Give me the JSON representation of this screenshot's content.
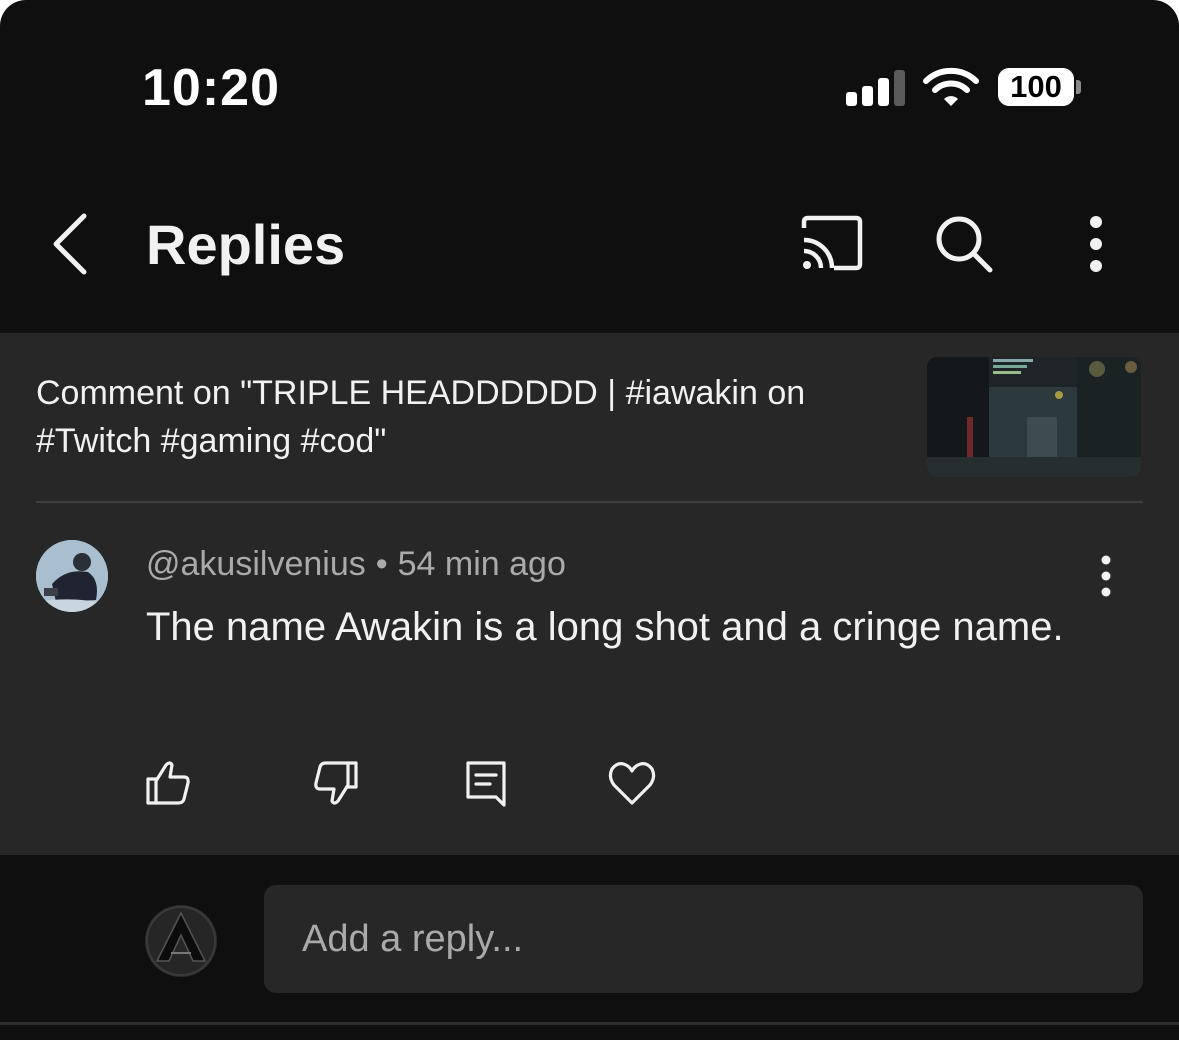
{
  "status_bar": {
    "time": "10:20",
    "battery": "100",
    "signal_bars": 3,
    "icons": [
      "signal-icon",
      "wifi-icon",
      "battery-icon"
    ]
  },
  "header": {
    "title": "Replies",
    "icons": [
      "back-arrow-icon",
      "cast-icon",
      "search-icon",
      "more-vertical-icon"
    ]
  },
  "video": {
    "context": "Comment on \"TRIPLE HEADDDDDD | #iawakin on #Twitch #gaming #cod\""
  },
  "comment": {
    "author": "@akusilvenius",
    "separator": "•",
    "time": "54 min ago",
    "text": "The name Awakin is a long shot and a cringe name.",
    "actions": [
      "like-icon",
      "dislike-icon",
      "reply-icon",
      "heart-icon"
    ]
  },
  "reply_box": {
    "placeholder": "Add a reply..."
  },
  "colors": {
    "background": "#0f0f0f",
    "panel": "#272727",
    "text": "#f1f1f1",
    "secondary_text": "#aaaaaa"
  }
}
